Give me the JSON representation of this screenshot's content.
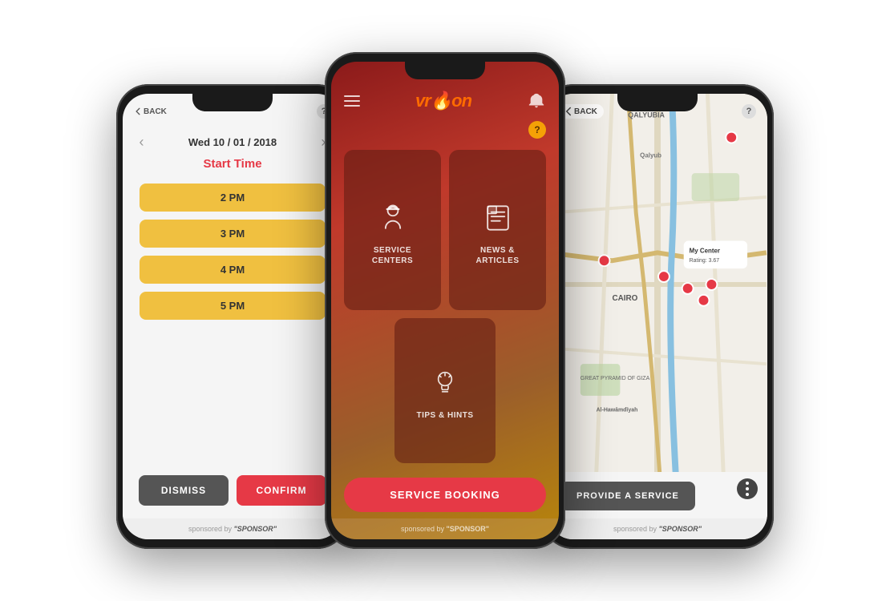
{
  "phone1": {
    "date": "Wed 10 / 01 / 2018",
    "startTimeLabel": "Start Time",
    "timeSlots": [
      "2 PM",
      "3 PM",
      "4 PM",
      "5 PM"
    ],
    "dismissLabel": "DISMISS",
    "confirmLabel": "CONFIRM",
    "sponsoredLabel": "sponsored by",
    "sponsorName": "\"SPONSOR\""
  },
  "phone2": {
    "appName": "vroon",
    "menuItems": [
      {
        "id": "service-centers",
        "label": "SERVICE\nCENTERS",
        "icon": "worker"
      },
      {
        "id": "news-articles",
        "label": "NEWS &\nARTICLES",
        "icon": "newspaper"
      },
      {
        "id": "tips-hints",
        "label": "TIPS & HINTS",
        "icon": "bulb"
      }
    ],
    "serviceBookingLabel": "SERVICE BOOKING",
    "sponsoredLabel": "sponsored by",
    "sponsorName": "\"SPONSOR\""
  },
  "phone3": {
    "backLabel": "BACK",
    "tooltip": {
      "title": "My Center",
      "rating": "Rating: 3.67"
    },
    "mapLabels": [
      "QALYUBIA",
      "Qalyub",
      "CAIRO",
      "Al-Hawāmdīyah"
    ],
    "provideServiceLabel": "PROVIDE A SERVICE",
    "sponsoredLabel": "sponsored by",
    "sponsorName": "\"SPONSOR\""
  }
}
